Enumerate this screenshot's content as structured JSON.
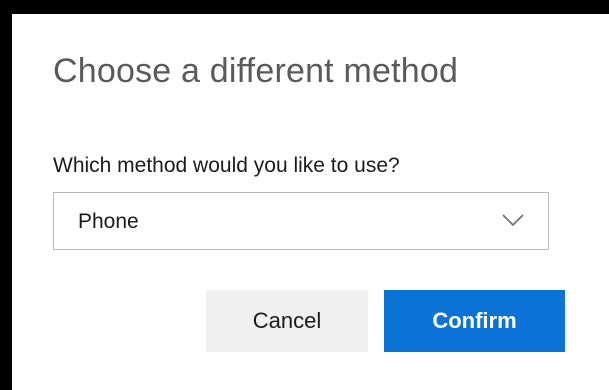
{
  "dialog": {
    "title": "Choose a different method",
    "question": "Which method would you like to use?",
    "method_select": {
      "selected": "Phone",
      "icon": "chevron-down-icon"
    },
    "buttons": {
      "cancel_label": "Cancel",
      "confirm_label": "Confirm"
    }
  },
  "colors": {
    "primary": "#0a73d5",
    "secondary_button": "#f0f0f0",
    "title_text": "#5a5a5a",
    "border": "#b9b9b9",
    "frame": "#000000"
  }
}
